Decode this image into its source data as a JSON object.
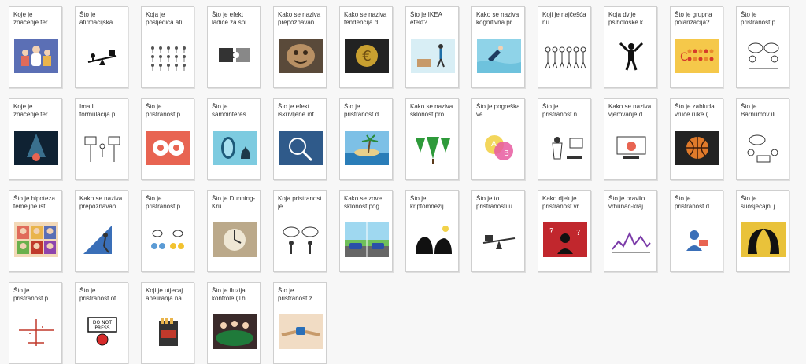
{
  "cards": [
    {
      "title": "Koje je značenje ter…",
      "icon": "people-group-icon",
      "bg": "#5b6fb5"
    },
    {
      "title": "Što je afirmacijska…",
      "icon": "seesaw-icon",
      "bg": "#ffffff"
    },
    {
      "title": "Koja je posljedica afi…",
      "icon": "crowd-icon",
      "bg": "#ffffff"
    },
    {
      "title": "Što je efekt ladice za spi…",
      "icon": "puzzle-icon",
      "bg": "#ffffff"
    },
    {
      "title": "Kako se naziva prepoznavan…",
      "icon": "face-in-wood-icon",
      "bg": "#5a4a3a"
    },
    {
      "title": "Kako se naziva tendencija d…",
      "icon": "euro-coin-icon",
      "bg": "#222222"
    },
    {
      "title": "Što je IKEA efekt?",
      "icon": "furniture-assembly-icon",
      "bg": "#d8eef5"
    },
    {
      "title": "Kako se naziva kognitivna pr…",
      "icon": "diver-icon",
      "bg": "#8fd3e8"
    },
    {
      "title": "Koji je najčešća nu…",
      "icon": "people-line-icon",
      "bg": "#ffffff"
    },
    {
      "title": "Koja dvije psihološke k…",
      "icon": "person-stretch-icon",
      "bg": "#ffffff"
    },
    {
      "title": "Što je grupna polarizacija?",
      "icon": "polarization-icon",
      "bg": "#f5c84a"
    },
    {
      "title": "Što je pristranost p…",
      "icon": "dialogue-icon",
      "bg": "#ffffff"
    },
    {
      "title": "Koje je značenje ter…",
      "icon": "spotlight-icon",
      "bg": "#0f2233"
    },
    {
      "title": "Ima li formulacija p…",
      "icon": "signpost-icon",
      "bg": "#ffffff"
    },
    {
      "title": "Što je pristranost p…",
      "icon": "heads-icon",
      "bg": "#e86452"
    },
    {
      "title": "Što je samointeres…",
      "icon": "mirror-cat-icon",
      "bg": "#7dcbe0"
    },
    {
      "title": "Što je efekt iskrivljene inf…",
      "icon": "magnifier-icon",
      "bg": "#2f5a8a"
    },
    {
      "title": "Što je pristranost d…",
      "icon": "island-icon",
      "bg": "#7dc0e6"
    },
    {
      "title": "Kako se naziva sklonost pro…",
      "icon": "trees-icon",
      "bg": "#ffffff"
    },
    {
      "title": "Što je pogreška ve…",
      "icon": "venn-icon",
      "bg": "#ffffff"
    },
    {
      "title": "Što je pristranost n…",
      "icon": "scientist-icon",
      "bg": "#ffffff"
    },
    {
      "title": "Kako se naziva vjerovanje d…",
      "icon": "computer-user-icon",
      "bg": "#ffffff"
    },
    {
      "title": "Što je zabluda vruće ruke (…",
      "icon": "basketball-icon",
      "bg": "#222222"
    },
    {
      "title": "Što je Barnumov ili…",
      "icon": "fortune-teller-icon",
      "bg": "#ffffff"
    },
    {
      "title": "Što je hipoteza temeljne isti…",
      "icon": "faces-grid-icon",
      "bg": "#f3d9b8"
    },
    {
      "title": "Kako se naziva prepoznavan…",
      "icon": "climber-icon",
      "bg": "#ffffff"
    },
    {
      "title": "Što je pristranost p…",
      "icon": "coins-icon",
      "bg": "#ffffff"
    },
    {
      "title": "Što je Dunning-Kru…",
      "icon": "sundial-icon",
      "bg": "#bba98a"
    },
    {
      "title": "Koja pristranost je…",
      "icon": "arguing-icon",
      "bg": "#ffffff"
    },
    {
      "title": "Kako se zove sklonost pog…",
      "icon": "cars-icon",
      "bg": "#6fbf5a"
    },
    {
      "title": "Što je kriptomnezij…",
      "icon": "thinkers-icon",
      "bg": "#ffffff"
    },
    {
      "title": "Što je to pristranosti u…",
      "icon": "balance-icon",
      "bg": "#ffffff"
    },
    {
      "title": "Kako djeluje pristranost vr…",
      "icon": "question-person-icon",
      "bg": "#c1272d"
    },
    {
      "title": "Što je pravilo vrhunac-kraj…",
      "icon": "peak-graph-icon",
      "bg": "#ffffff"
    },
    {
      "title": "Što je pristranost d…",
      "icon": "reading-icon",
      "bg": "#ffffff"
    },
    {
      "title": "Što je suosjećajni j…",
      "icon": "two-heads-icon",
      "bg": "#e9c23a"
    },
    {
      "title": "Što je pristranost p…",
      "icon": "airplane-icon",
      "bg": "#ffffff"
    },
    {
      "title": "Što je pristranost ot…",
      "icon": "do-not-press-icon",
      "bg": "#ffffff"
    },
    {
      "title": "Koji je utjecaj apeliranja na…",
      "icon": "cigarette-pack-icon",
      "bg": "#ffffff"
    },
    {
      "title": "Što je iluzija kontrole (Th…",
      "icon": "casino-icon",
      "bg": "#3a2a2a"
    },
    {
      "title": "Što je pristranost z…",
      "icon": "handshake-icon",
      "bg": "#f1dcc4"
    }
  ]
}
